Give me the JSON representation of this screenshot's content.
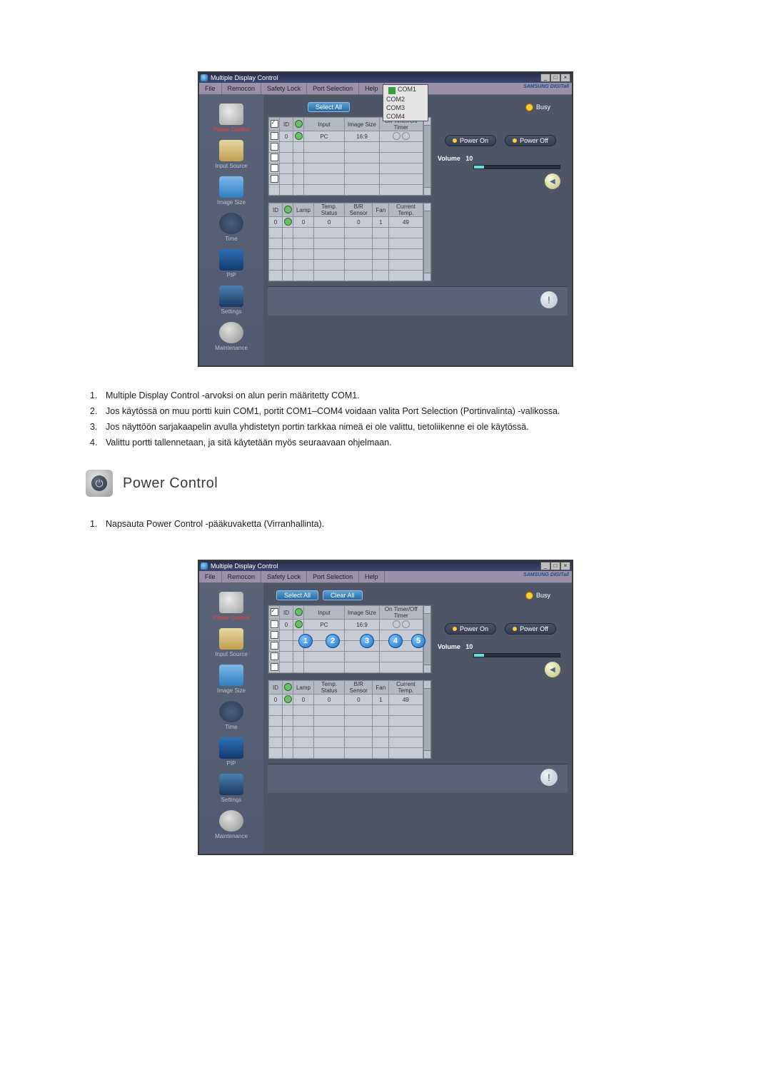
{
  "app": {
    "title": "Multiple Display Control",
    "brand": "SAMSUNG DIGITall",
    "menu": [
      "File",
      "Remocon",
      "Safety Lock",
      "Port Selection",
      "Help"
    ],
    "port_dropdown": [
      "COM1",
      "COM2",
      "COM3",
      "COM4"
    ]
  },
  "sidebar": {
    "items": [
      {
        "label": "Power Control",
        "active": true
      },
      {
        "label": "Input Source"
      },
      {
        "label": "Image Size"
      },
      {
        "label": "Time"
      },
      {
        "label": "PIP"
      },
      {
        "label": "Settings"
      },
      {
        "label": "Maintenance"
      }
    ]
  },
  "toolbar": {
    "select_all": "Select All",
    "clear_all": "Clear All",
    "busy": "Busy"
  },
  "grid_top": {
    "headers_chk": "✓",
    "headers": [
      "ID",
      "",
      "Input",
      "Image Size",
      "On Timer/Off Timer"
    ],
    "row": {
      "id": "0",
      "input": "PC",
      "image_size": "16:9"
    }
  },
  "grid_bottom": {
    "headers": [
      "ID",
      "",
      "Lamp",
      "Temp. Status",
      "B/R Sensor",
      "Fan",
      "Current Temp."
    ],
    "row": {
      "id": "0",
      "lamp": "0",
      "temp_status": "0",
      "br": "0",
      "fan": "1",
      "current_temp": "49"
    }
  },
  "right_panel": {
    "power_on": "Power On",
    "power_off": "Power Off",
    "volume_label": "Volume",
    "volume_value": "10"
  },
  "doc": {
    "list1": [
      "Multiple Display Control -arvoksi on alun perin määritetty COM1.",
      "Jos käytössä on muu portti kuin COM1, portit COM1–COM4 voidaan valita Port Selection (Portinvalinta) -valikossa.",
      "Jos näyttöön sarjakaapelin avulla yhdistetyn portin tarkkaa nimeä ei ole valittu, tietoliikenne ei ole käytössä.",
      "Valittu portti tallennetaan, ja sitä käytetään myös seuraavaan ohjelmaan."
    ],
    "section_title": "Power Control",
    "list2": [
      "Napsauta Power Control -pääkuvaketta (Virranhallinta)."
    ]
  },
  "markers": [
    "1",
    "2",
    "3",
    "4",
    "5"
  ]
}
